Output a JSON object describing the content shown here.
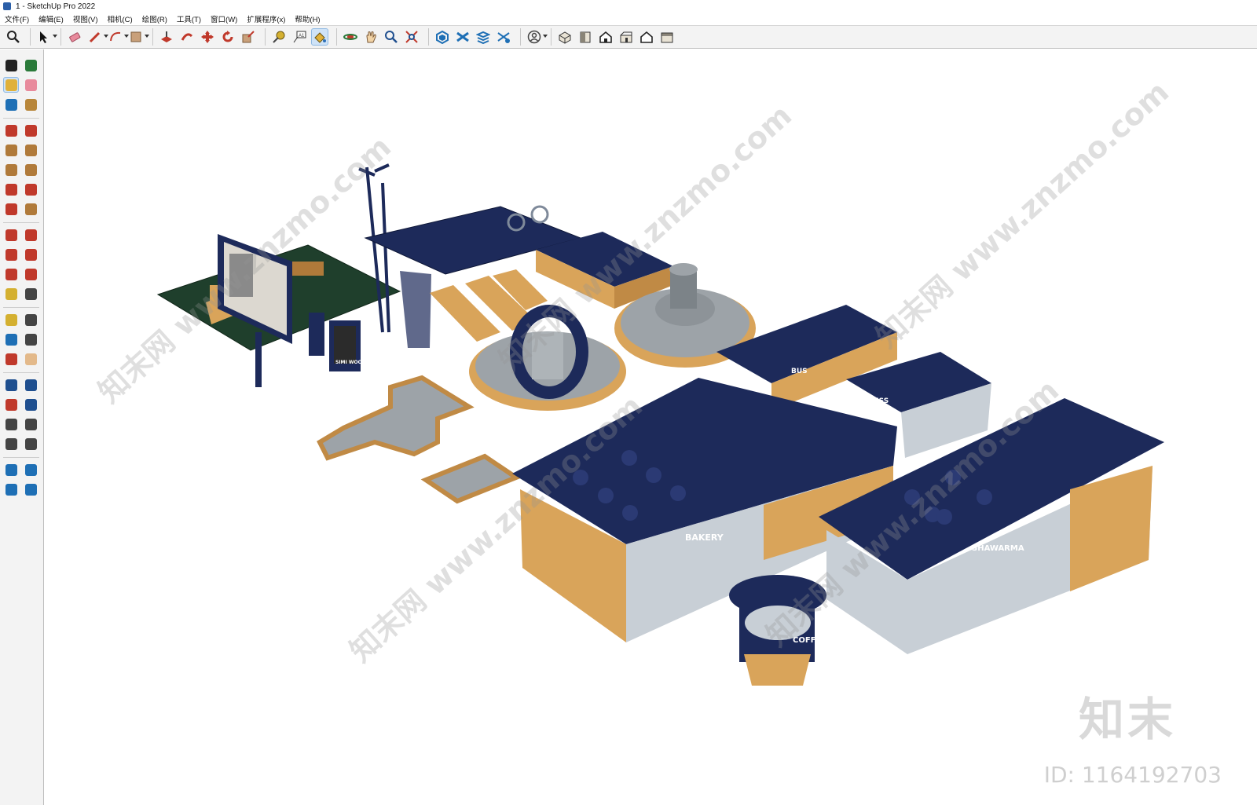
{
  "window": {
    "title": "1 - SketchUp Pro 2022"
  },
  "menubar": {
    "items": [
      "文件(F)",
      "编辑(E)",
      "视图(V)",
      "相机(C)",
      "绘图(R)",
      "工具(T)",
      "窗口(W)",
      "扩展程序(x)",
      "帮助(H)"
    ]
  },
  "toolbar": {
    "icons": [
      "zoom-icon",
      "select-icon",
      "eraser-icon",
      "pencil-icon",
      "arc-icon",
      "rectangle-icon",
      "push-pull-icon",
      "follow-me-icon",
      "move-icon",
      "rotate-icon",
      "scale-icon",
      "tape-measure-icon",
      "text-icon",
      "paint-bucket-icon",
      "orbit-icon",
      "pan-icon",
      "zoom-window-icon",
      "zoom-extents-icon",
      "3d-warehouse-icon",
      "extension-warehouse-icon",
      "layout-icon",
      "trimble-connect-icon",
      "user-account-icon",
      "iso-view-icon",
      "top-view-icon",
      "front-view-icon",
      "right-view-icon",
      "back-view-icon",
      "left-view-icon"
    ],
    "active": "paint-bucket-icon"
  },
  "scene": {
    "labels": {
      "bakery": "BAKERY",
      "shawarma": "SHAWARMA",
      "coffee": "COFFE",
      "bus": "BUS",
      "press": "PRESS",
      "poster": "SIMI WOODS"
    }
  },
  "watermark": {
    "logo": "知末",
    "id": "ID: 1164192703",
    "diagonal": "知末网 www.znzmo.com"
  },
  "colors": {
    "roof": "#1d2a5a",
    "wood": "#d9a45a",
    "glass": "#c8cfd6",
    "concrete": "#9da3a8",
    "grass": "#1f3f2c",
    "accent_active": "#cfe3f7"
  }
}
